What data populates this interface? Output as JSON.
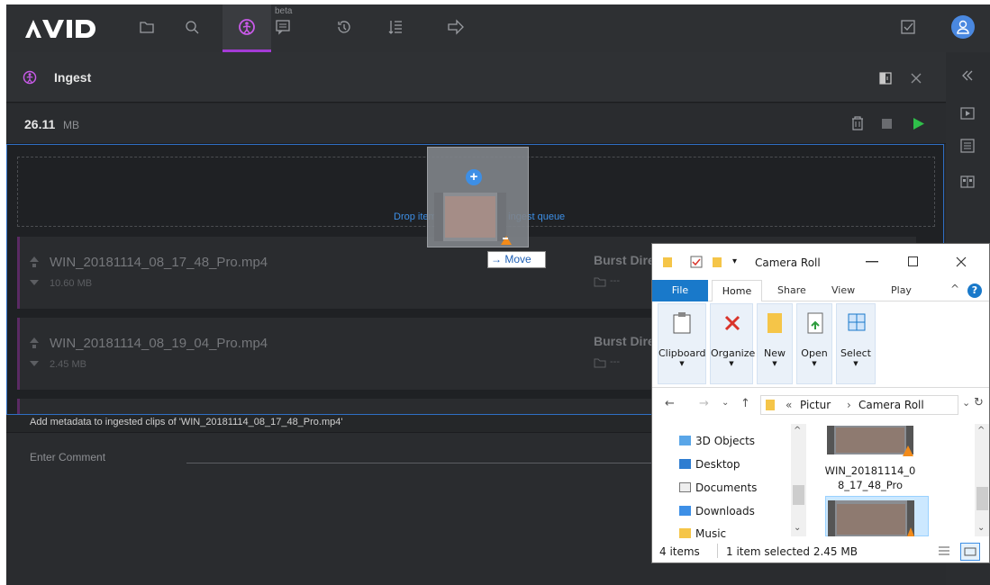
{
  "topbar": {
    "logo": "AVID",
    "beta_label": "beta",
    "icons": [
      "folder-icon",
      "search-icon",
      "ingest-icon",
      "chat-icon",
      "history-icon",
      "queue-list-icon",
      "forward-icon",
      "task-check-icon",
      "user-avatar-icon"
    ],
    "accent_color": "#a43bd6"
  },
  "panel": {
    "title": "Ingest",
    "size_value": "26.11",
    "size_unit": "MB",
    "drop_hint": "Drop items here to add to ingest queue",
    "clips": [
      {
        "name": "WIN_20181114_08_17_48_Pro.mp4",
        "size": "10.60 MB",
        "destination": "Burst Dire",
        "dest_status": "---"
      },
      {
        "name": "WIN_20181114_08_19_04_Pro.mp4",
        "size": "2.45 MB",
        "destination": "Burst Dire",
        "dest_status": "---"
      }
    ],
    "metadata_title": "Add metadata to ingested clips of 'WIN_20181114_08_17_48_Pro.mp4'",
    "comment_placeholder": "Enter Comment"
  },
  "drag": {
    "move_label": "→ Move"
  },
  "explorer": {
    "title": "Camera Roll",
    "tabs": {
      "file": "File",
      "home": "Home",
      "share": "Share",
      "view": "View",
      "play": "Play"
    },
    "ribbon": [
      "Clipboard",
      "Organize",
      "New",
      "Open",
      "Select"
    ],
    "address": {
      "prefix": "«",
      "part1": "Pictur",
      "sep": "›",
      "part2": "Camera Roll"
    },
    "nav_items": [
      "3D Objects",
      "Desktop",
      "Documents",
      "Downloads",
      "Music"
    ],
    "file_label_1": "WIN_20181114_0",
    "file_label_2": "8_17_48_Pro",
    "status_count": "4 items",
    "status_selection": "1 item selected  2.45 MB"
  }
}
